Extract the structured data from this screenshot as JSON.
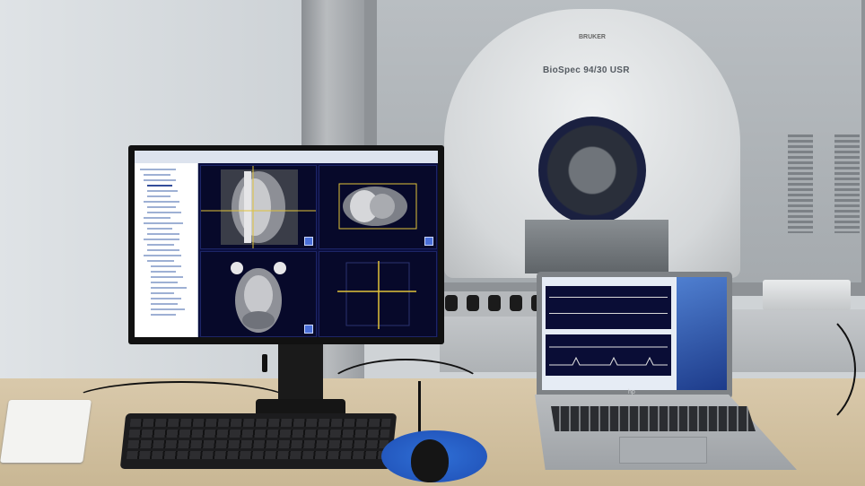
{
  "scene": {
    "scanner_model_text": "BioSpec 94/30 USR",
    "scanner_brand_text": "BRUKER",
    "mousepad_text": "",
    "laptop_brand_mark": "hp"
  },
  "colors": {
    "viewer_background": "#0b0f40",
    "crosshair": "#e0c23a",
    "mousepad": "#2f6fd6",
    "desk": "#d9c9ab"
  },
  "icons": {
    "monitor": "desktop-monitor-icon",
    "laptop": "laptop-icon",
    "mouse": "mouse-icon",
    "keyboard": "keyboard-icon"
  }
}
